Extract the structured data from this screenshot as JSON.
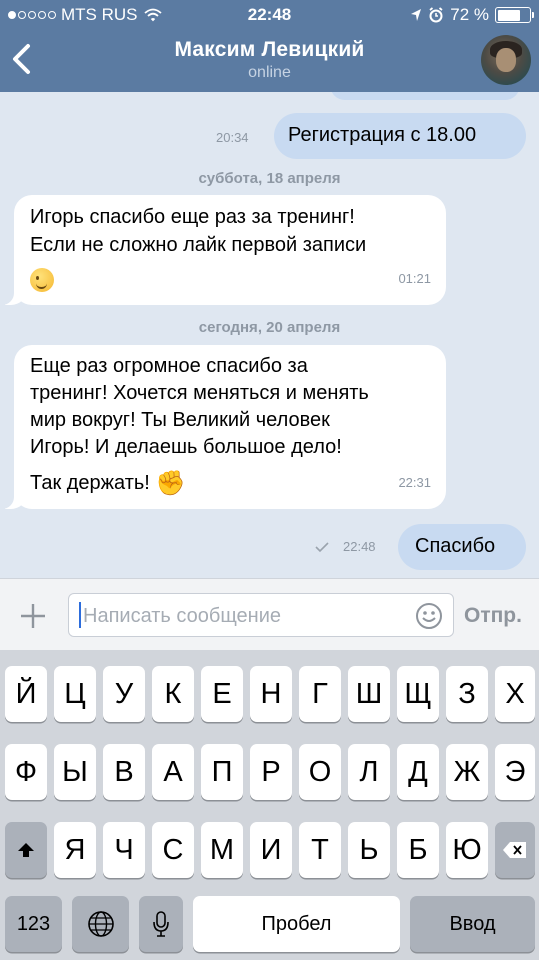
{
  "status_bar": {
    "carrier": "MTS RUS",
    "time": "22:48",
    "battery": "72 %",
    "battery_level": 0.72
  },
  "header": {
    "title": "Максим Левицкий",
    "subtitle": "online"
  },
  "messages": [
    {
      "direction": "out",
      "text": "Регистрация с 18.00",
      "time": "20:34"
    },
    {
      "type": "date",
      "text": "суббота, 18 апреля"
    },
    {
      "direction": "in",
      "text": "Игорь спасибо еще раз за тренинг!\nЕсли не сложно лайк первой записи",
      "emoji": "wink-emoji",
      "time": "01:21"
    },
    {
      "type": "date",
      "text": "сегодня, 20 апреля"
    },
    {
      "direction": "in",
      "text": "Еще раз огромное спасибо за\nтренинг! Хочется меняться и менять\nмир вокруг! Ты Великий человек\nИгорь! И делаешь большое дело!",
      "text2": "Так держать!",
      "emoji": "thumbs-up-emoji",
      "time": "22:31"
    },
    {
      "direction": "out",
      "text": "Спасибо",
      "time": "22:48",
      "status": "sent-check"
    }
  ],
  "compose": {
    "placeholder": "Написать сообщение",
    "send_label": "Отпр."
  },
  "keyboard": {
    "row1": [
      "Й",
      "Ц",
      "У",
      "К",
      "Е",
      "Н",
      "Г",
      "Ш",
      "Щ",
      "З",
      "Х"
    ],
    "row2": [
      "Ф",
      "Ы",
      "В",
      "А",
      "П",
      "Р",
      "О",
      "Л",
      "Д",
      "Ж",
      "Э"
    ],
    "row3": [
      "Я",
      "Ч",
      "С",
      "М",
      "И",
      "Т",
      "Ь",
      "Б",
      "Ю"
    ],
    "numbers_label": "123",
    "space_label": "Пробел",
    "return_label": "Ввод"
  },
  "colors": {
    "header": "#5b7ba2",
    "chat_bg": "#dfe7f1",
    "outgoing_bubble": "#c8daf1",
    "incoming_bubble": "#ffffff",
    "keyboard_bg": "#d1d5db"
  }
}
